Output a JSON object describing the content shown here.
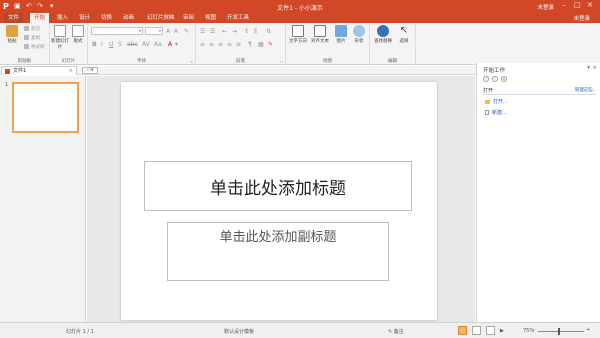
{
  "app": {
    "logo": "P",
    "title": "文件1 - 小小演示",
    "user": "未登录"
  },
  "menu": {
    "tabs": [
      "文件",
      "开始",
      "插入",
      "设计",
      "切换",
      "动画",
      "幻灯片放映",
      "审阅",
      "视图",
      "开发工具"
    ],
    "active": "开始",
    "user_label": "未登录"
  },
  "ribbon": {
    "clipboard": {
      "paste": "粘贴",
      "cut": "剪切",
      "copy": "复制",
      "format_painter": "格式刷",
      "label": "剪贴板"
    },
    "slides": {
      "new_slide": "新建幻灯片",
      "layout": "版式",
      "label": "幻灯片"
    },
    "font": {
      "label": "字体"
    },
    "paragraph": {
      "label": "段落"
    },
    "drawing": {
      "text_direction": "文字方向",
      "align_text": "对齐文本",
      "picture": "图片",
      "shapes": "形状",
      "label": "绘图"
    },
    "editing": {
      "find_replace": "查找替换",
      "select": "选择",
      "label": "编辑"
    }
  },
  "document_tab": {
    "name": "文件1"
  },
  "slide_panel": {
    "slide_number": "1"
  },
  "slide": {
    "title_placeholder": "单击此处添加标题",
    "subtitle_placeholder": "单击此处添加副标题"
  },
  "task_pane": {
    "title": "开始工作",
    "section": "打开",
    "more_link": "管理这些...",
    "links": [
      "打开...",
      "新建..."
    ]
  },
  "status": {
    "slide_count": "幻灯片 1 / 1",
    "theme": "默认设计模板",
    "notes": "备注",
    "zoom": "75%"
  },
  "colors": {
    "accent": "#d24726",
    "thumb_selected": "#f0a054"
  }
}
